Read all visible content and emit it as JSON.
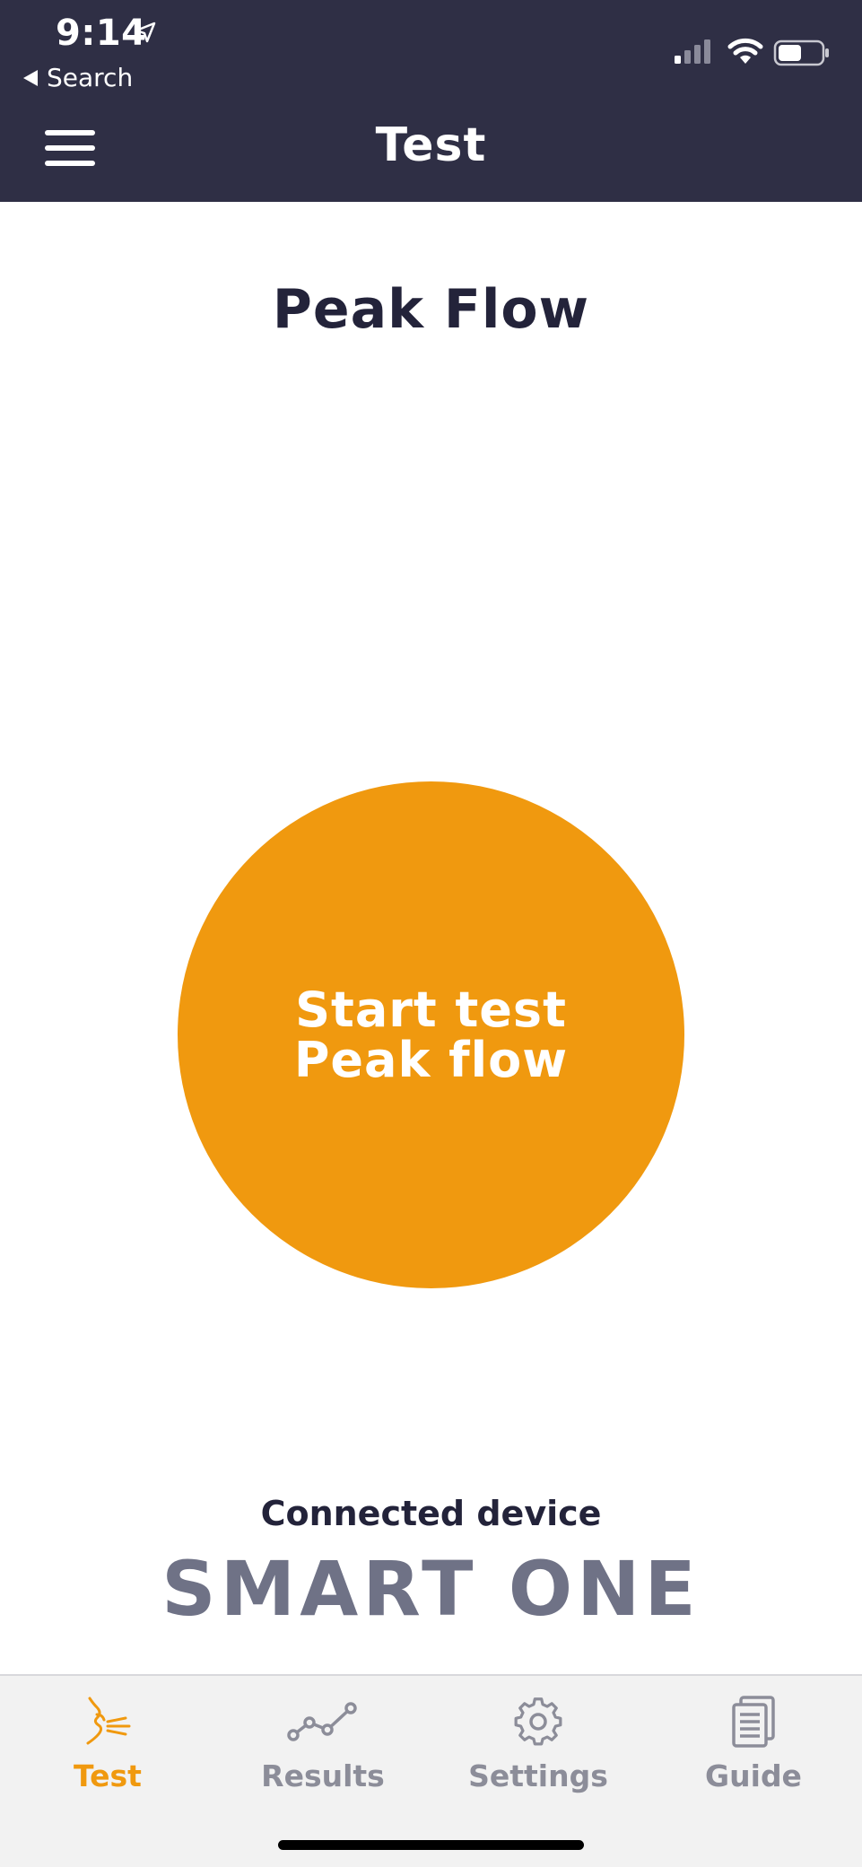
{
  "status_bar": {
    "time": "9:14",
    "back_label": "Search",
    "icons": [
      "location-arrow-icon",
      "signal-icon",
      "wifi-icon",
      "battery-icon"
    ]
  },
  "header": {
    "title": "Test",
    "menu_icon": "hamburger-menu-icon"
  },
  "main": {
    "page_title": "Peak Flow",
    "start_button": {
      "line1": "Start test",
      "line2": "Peak flow"
    },
    "connected_label": "Connected device",
    "device_name": "SMART ONE"
  },
  "tabs": [
    {
      "label": "Test",
      "icon": "breath-test-icon",
      "active": true
    },
    {
      "label": "Results",
      "icon": "line-graph-icon",
      "active": false
    },
    {
      "label": "Settings",
      "icon": "gear-icon",
      "active": false
    },
    {
      "label": "Guide",
      "icon": "document-icon",
      "active": false
    }
  ],
  "colors": {
    "header_bg": "#2f2f45",
    "accent": "#f0990f",
    "inactive_tab": "#8c8d99",
    "device_name": "#6f7286"
  }
}
